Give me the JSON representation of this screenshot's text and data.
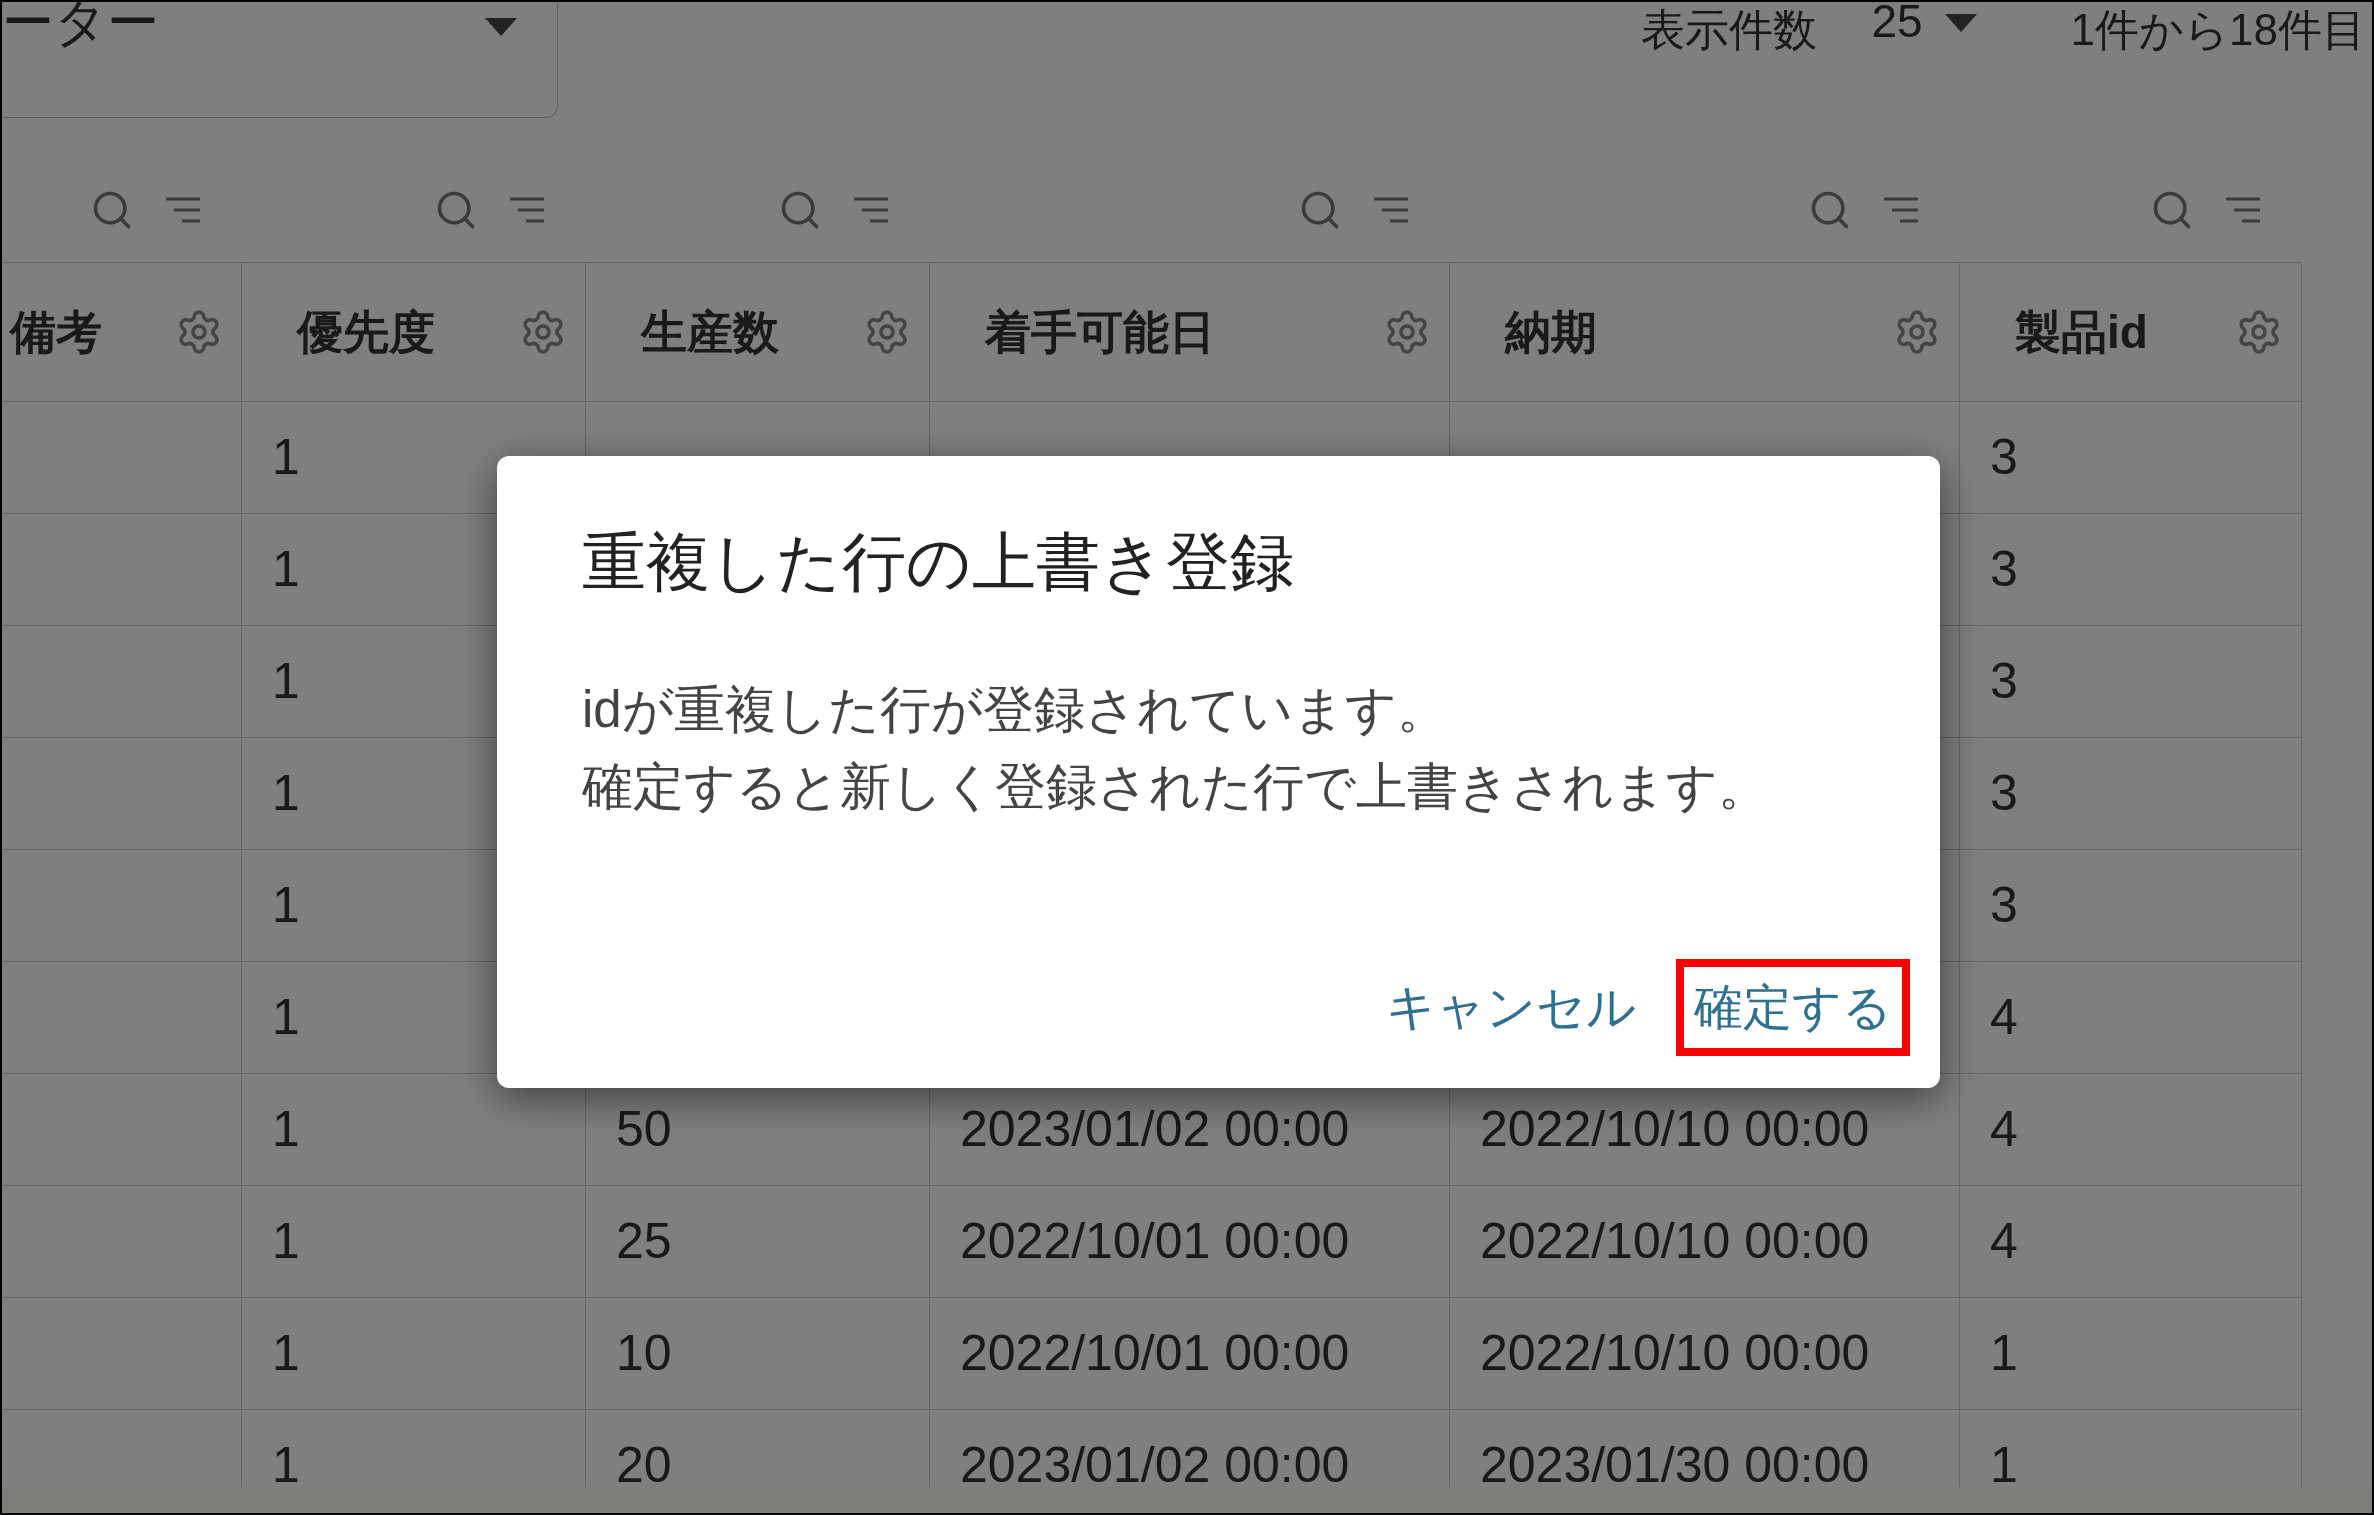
{
  "filter_dropdown": {
    "value": "ーター"
  },
  "page_size": {
    "label": "表示件数",
    "value": "25"
  },
  "range_text": "1件から18件目",
  "table": {
    "columns": [
      {
        "label": "備考"
      },
      {
        "label": "優先度"
      },
      {
        "label": "生産数"
      },
      {
        "label": "着手可能日"
      },
      {
        "label": "納期"
      },
      {
        "label": "製品id"
      }
    ],
    "rows": [
      [
        null,
        "1",
        null,
        null,
        null,
        "3"
      ],
      [
        null,
        "1",
        null,
        null,
        null,
        "3"
      ],
      [
        null,
        "1",
        null,
        null,
        null,
        "3"
      ],
      [
        null,
        "1",
        null,
        null,
        null,
        "3"
      ],
      [
        null,
        "1",
        null,
        null,
        null,
        "3"
      ],
      [
        null,
        "1",
        null,
        null,
        null,
        "4"
      ],
      [
        null,
        "1",
        "50",
        "2023/01/02 00:00",
        "2022/10/10 00:00",
        "4"
      ],
      [
        null,
        "1",
        "25",
        "2022/10/01 00:00",
        "2022/10/10 00:00",
        "4"
      ],
      [
        null,
        "1",
        "10",
        "2022/10/01 00:00",
        "2022/10/10 00:00",
        "1"
      ],
      [
        null,
        "1",
        "20",
        "2023/01/02 00:00",
        "2023/01/30 00:00",
        "1"
      ]
    ]
  },
  "dialog": {
    "title": "重複した行の上書き登録",
    "message": [
      "idが重複した行が登録されています。",
      "確定すると新しく登録された行で上書きされます。"
    ],
    "actions": [
      {
        "label": "キャンセル",
        "highlighted": false
      },
      {
        "label": "確定する",
        "highlighted": true
      }
    ]
  }
}
